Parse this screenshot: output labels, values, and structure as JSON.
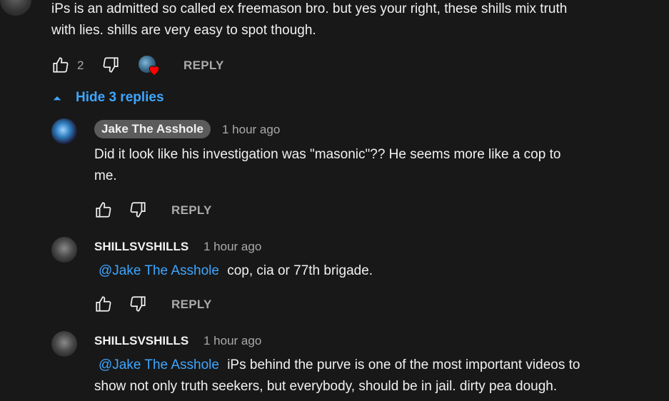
{
  "top_comment": {
    "text_line1": "iPs is an admitted so called ex freemason bro. but yes your right, these shills mix truth",
    "text_line2": "with lies. shills are very easy to spot though.",
    "like_count": "2",
    "reply_label": "REPLY",
    "hide_replies_label": "Hide 3 replies"
  },
  "replies": [
    {
      "author": "Jake The Asshole",
      "time": "1 hour ago",
      "text_line1": "Did it look like his investigation was \"masonic\"?? He seems more like a cop to",
      "text_line2": "me.",
      "reply_label": "REPLY"
    },
    {
      "author": "SHILLSVSHILLS",
      "time": "1 hour ago",
      "mention": "@Jake The Asshole",
      "text_line1": "cop, cia or 77th brigade.",
      "reply_label": "REPLY"
    },
    {
      "author": "SHILLSVSHILLS",
      "time": "1 hour ago",
      "mention": "@Jake The Asshole",
      "text_line1": "iPs behind the purve is one of the most important videos to",
      "text_line2": "show not only truth seekers, but everybody, should be in jail. dirty pea dough."
    }
  ],
  "colors": {
    "background": "#181818",
    "link": "#3ea6ff",
    "muted": "#aaaaaa",
    "heart": "#ff0000"
  },
  "icons": [
    "thumbs-up-icon",
    "thumbs-down-icon",
    "creator-heart-icon",
    "caret-up-icon"
  ]
}
